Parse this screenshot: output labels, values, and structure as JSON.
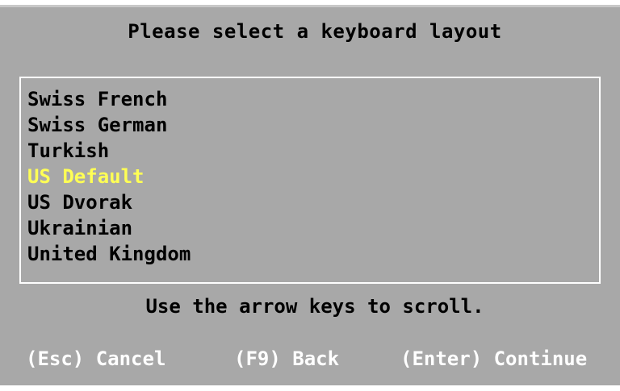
{
  "dialog": {
    "title": "Please select a keyboard layout",
    "hint": "Use the arrow keys to scroll."
  },
  "layouts": [
    {
      "label": "Swiss French",
      "selected": false
    },
    {
      "label": "Swiss German",
      "selected": false
    },
    {
      "label": "Turkish",
      "selected": false
    },
    {
      "label": "US Default",
      "selected": true
    },
    {
      "label": "US Dvorak",
      "selected": false
    },
    {
      "label": "Ukrainian",
      "selected": false
    },
    {
      "label": "United Kingdom",
      "selected": false
    }
  ],
  "footer": {
    "cancel": "(Esc) Cancel",
    "back": "(F9) Back",
    "continue": "(Enter) Continue"
  },
  "colors": {
    "background": "#a8a8a8",
    "text": "#000000",
    "selected": "#ffff55",
    "footer_text": "#ffffff",
    "border": "#ffffff"
  }
}
